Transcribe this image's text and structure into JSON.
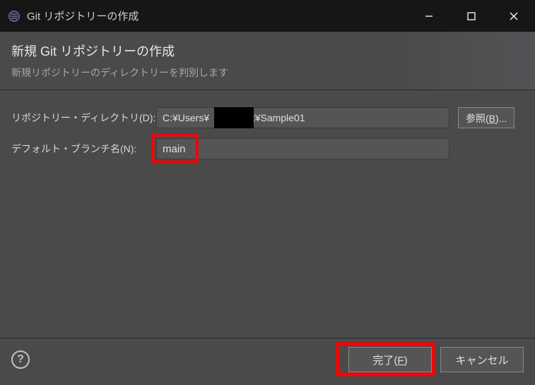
{
  "titlebar": {
    "title": "Git リポジトリーの作成"
  },
  "header": {
    "title": "新規 Git リポジトリーの作成",
    "subtitle": "新規リポジトリーのディレクトリーを判別します"
  },
  "form": {
    "dir_label": "リポジトリー・ディレクトリ(D):",
    "dir_value": "C:¥Users¥   ¥git¥Sample01",
    "browse_prefix": "参照(",
    "browse_mnemonic": "B",
    "browse_suffix": ")...",
    "branch_label": "デフォルト・ブランチ名(N):",
    "branch_value": "main"
  },
  "footer": {
    "finish_prefix": "完了(",
    "finish_mnemonic": "F",
    "finish_suffix": ")",
    "cancel_label": "キャンセル",
    "help": "?"
  }
}
